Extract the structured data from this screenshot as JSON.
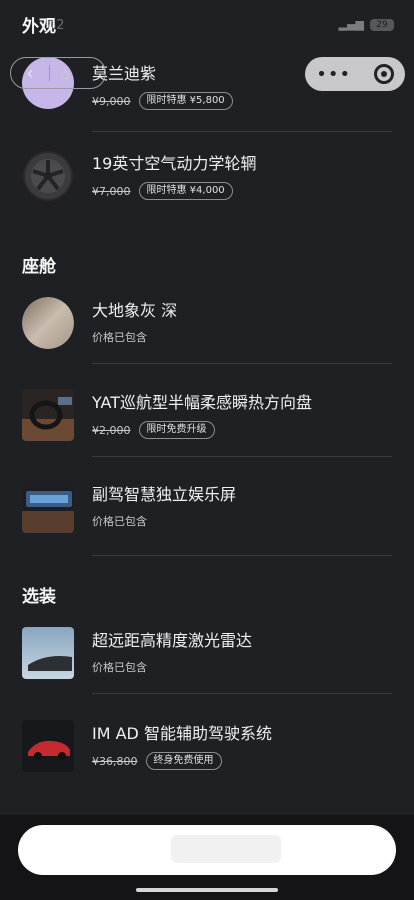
{
  "status": {
    "time": "42",
    "battery": "29"
  },
  "nav": {
    "back_icon": "‹",
    "home_icon": "⌂"
  },
  "capsule": {
    "more_icon": "•••"
  },
  "sections": {
    "exterior": "外观",
    "cabin": "座舱",
    "options": "选装"
  },
  "items": [
    {
      "name": "莫兰迪紫",
      "price": "¥9,000",
      "tag": "限时特惠 ¥5,800"
    },
    {
      "name": "19英寸空气动力学轮辋",
      "price": "¥7,000",
      "tag": "限时特惠 ¥4,000"
    },
    {
      "name": "大地象灰 深",
      "note": "价格已包含"
    },
    {
      "name": "YAT巡航型半幅柔感瞬热方向盘",
      "price": "¥2,000",
      "tag": "限时免费升级"
    },
    {
      "name": "副驾智慧独立娱乐屏",
      "note": "价格已包含"
    },
    {
      "name": "超远距高精度激光雷达",
      "note": "价格已包含"
    },
    {
      "name": "IM AD 智能辅助驾驶系统",
      "price": "¥36,800",
      "tag": "终身免费使用"
    }
  ],
  "colors": {
    "background": "#1f2024",
    "swatch_purple": "#c7b6e8",
    "cta": "#ffffff"
  }
}
